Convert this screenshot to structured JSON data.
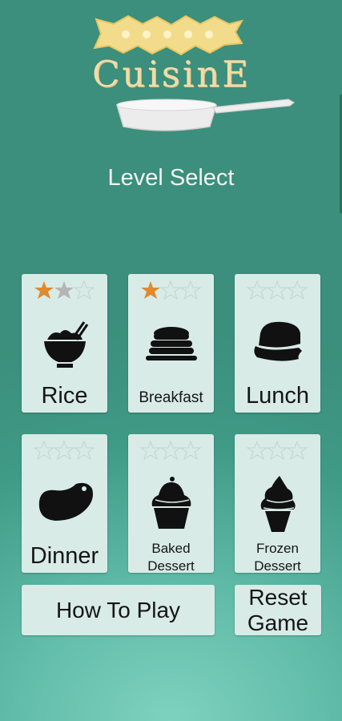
{
  "header": {
    "logo_text": "CuisinE",
    "title": "Level Select"
  },
  "levels": [
    {
      "label": "Rice",
      "stars_earned": [
        "gold",
        "silver"
      ],
      "icon": "rice-bowl-icon"
    },
    {
      "label": "Breakfast",
      "stars_earned": [
        "gold"
      ],
      "icon": "pancakes-icon"
    },
    {
      "label": "Lunch",
      "stars_earned": [],
      "icon": "sandwich-icon"
    },
    {
      "label": "Dinner",
      "stars_earned": [],
      "icon": "steak-icon"
    },
    {
      "label": "Baked Dessert",
      "line1": "Baked",
      "line2": "Dessert",
      "stars_earned": [],
      "icon": "cupcake-icon"
    },
    {
      "label": "Frozen Dessert",
      "line1": "Frozen",
      "line2": "Dessert",
      "stars_earned": [],
      "icon": "ice-cream-icon"
    }
  ],
  "stars_per_level": 3,
  "buttons": {
    "how_to_play": "How To Play",
    "reset_line1": "Reset",
    "reset_line2": "Game"
  },
  "colors": {
    "gold_star": "#e08a2c",
    "silver_star": "#b5b5b5",
    "card_bg": "#d8ebe6",
    "logo_text": "#f1dca7"
  }
}
